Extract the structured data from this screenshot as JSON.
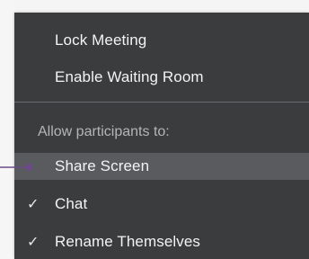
{
  "menu": {
    "items_top": [
      {
        "label": "Lock Meeting"
      },
      {
        "label": "Enable Waiting Room"
      }
    ],
    "section_label": "Allow participants to:",
    "items_permissions": [
      {
        "label": "Share Screen",
        "checked": false,
        "highlighted": true
      },
      {
        "label": "Chat",
        "checked": true,
        "highlighted": false
      },
      {
        "label": "Rename Themselves",
        "checked": true,
        "highlighted": false
      }
    ]
  },
  "icons": {
    "check_glyph": "✓",
    "pointer_color": "#6b4a87"
  }
}
